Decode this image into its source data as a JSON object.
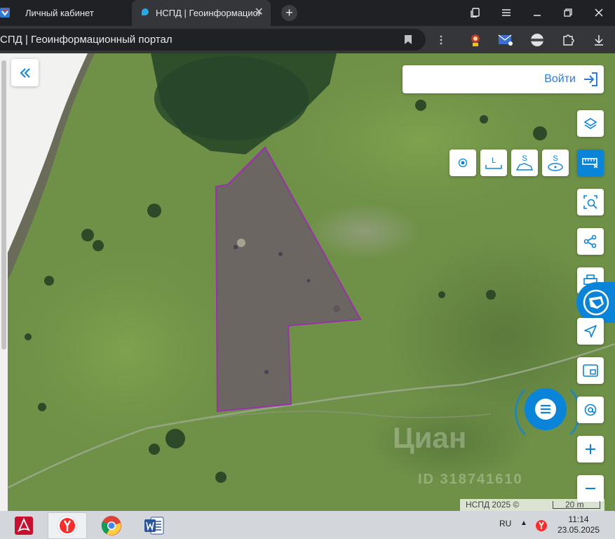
{
  "browser": {
    "tabs": [
      {
        "title": "Личный кабинет",
        "active": false
      },
      {
        "title": "НСПД | Геоинформационный портал",
        "active": true
      }
    ],
    "url_text": "СПД | Геоинформационный портал",
    "new_tab_label": "+",
    "tab_close_label": "✕"
  },
  "map": {
    "login_label": "Войти",
    "draw_tools": [
      {
        "name": "point",
        "label": ""
      },
      {
        "name": "length",
        "label": "L"
      },
      {
        "name": "area-polygon",
        "label": "S"
      },
      {
        "name": "area-circle",
        "label": "S"
      }
    ],
    "copyright": "НСПД 2025 ©",
    "scale_label": "20 m",
    "watermark": "Циан",
    "watermark_id": "ID 318741610",
    "parcel_outline_color": "#9b2fae"
  },
  "taskbar": {
    "language": "RU",
    "time": "11:14",
    "date": "23.05.2025"
  },
  "colors": {
    "accent": "#0a84d8",
    "chrome_dark": "#202124",
    "taskbar": "#d3d7dc"
  }
}
